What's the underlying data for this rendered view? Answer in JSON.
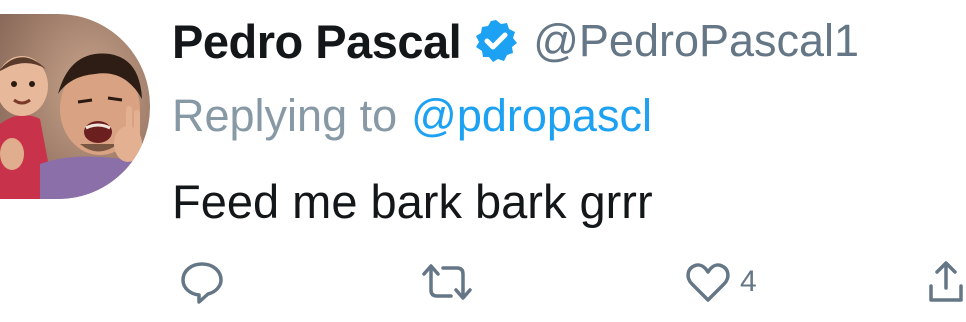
{
  "tweet": {
    "display_name": "Pedro Pascal",
    "handle": "@PedroPascal1",
    "reply_prefix": "Replying to",
    "reply_to": "@pdropascl",
    "text": "Feed me bark bark grrr"
  },
  "actions": {
    "reply_icon": "speech-bubble-icon",
    "retweet_icon": "retweet-arrows-icon",
    "like_icon": "heart-icon",
    "like_count": "4",
    "share_icon": "share-upload-icon"
  },
  "colors": {
    "text_primary": "#14171a",
    "text_secondary": "#657786",
    "link_blue": "#1da1f2",
    "verified_blue": "#1da1f2"
  }
}
